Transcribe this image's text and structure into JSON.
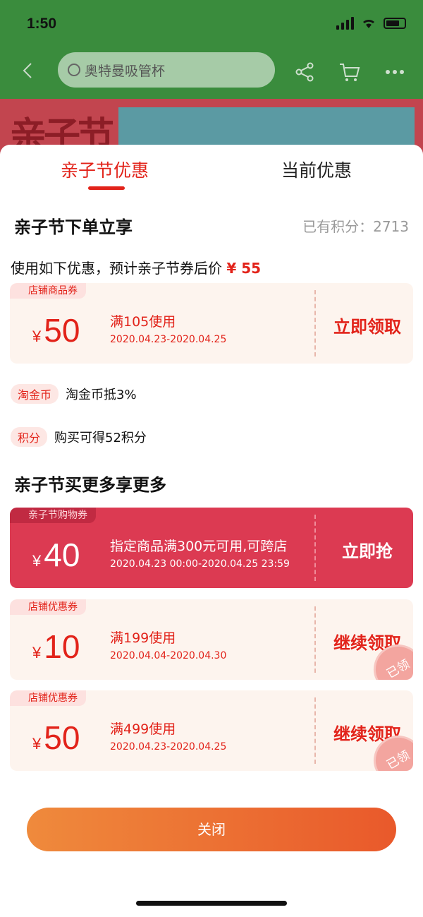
{
  "status_bar": {
    "time": "1:50"
  },
  "nav": {
    "search_placeholder": "奥特曼吸管杯",
    "banner_text": "亲子节"
  },
  "tabs": [
    {
      "label": "亲子节优惠",
      "active": true
    },
    {
      "label": "当前优惠",
      "active": false
    }
  ],
  "section1": {
    "title": "亲子节下单立享",
    "points_label": "已有积分：2713",
    "hint_prefix": "使用如下优惠，预计亲子节券后价",
    "hint_price": "¥ 55"
  },
  "coupons_top": [
    {
      "tag": "店铺商品券",
      "currency": "¥",
      "amount": "50",
      "condition": "满105使用",
      "date": "2020.04.23-2020.04.25",
      "action": "立即领取"
    }
  ],
  "benefits": [
    {
      "pill": "淘金币",
      "text": "淘金币抵3%"
    },
    {
      "pill": "积分",
      "text": "购买可得52积分"
    }
  ],
  "section2": {
    "title": "亲子节买更多享更多"
  },
  "coupons_more": [
    {
      "tag": "亲子节购物券",
      "currency": "¥",
      "amount": "40",
      "condition": "指定商品满300元可用,可跨店",
      "date": "2020.04.23 00:00-2020.04.25 23:59",
      "action": "立即抢",
      "style": "red"
    },
    {
      "tag": "店铺优惠券",
      "currency": "¥",
      "amount": "10",
      "condition": "满199使用",
      "date": "2020.04.04-2020.04.30",
      "action": "继续领取",
      "stamp": "已领"
    },
    {
      "tag": "店铺优惠券",
      "currency": "¥",
      "amount": "50",
      "condition": "满499使用",
      "date": "2020.04.23-2020.04.25",
      "action": "继续领取",
      "stamp": "已领"
    }
  ],
  "footer": {
    "close_label": "关闭"
  },
  "colors": {
    "accent": "#e2231a",
    "coupon_red": "#dc3a52",
    "coupon_bg": "#fdf4ee"
  }
}
